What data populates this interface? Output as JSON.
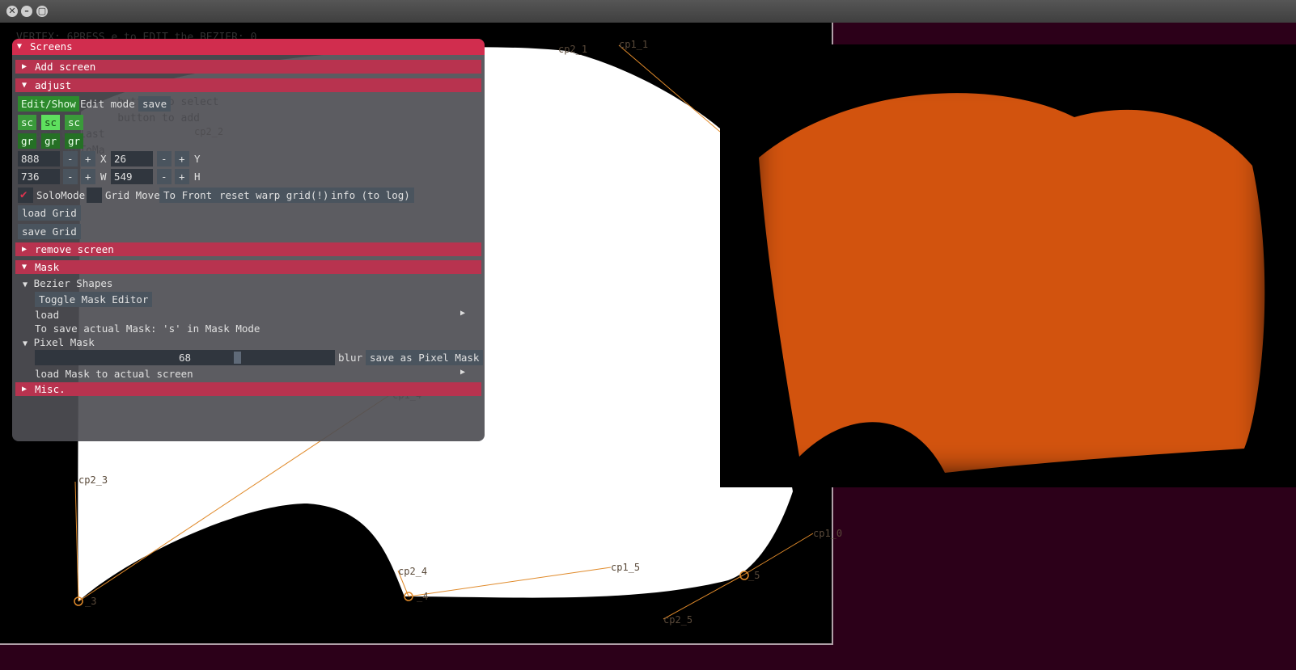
{
  "window": {
    "close_glyph": "✕",
    "min_glyph": "–",
    "max_glyph": "▢"
  },
  "background_text": "VERTEX: 6PRESS e to EDIT the BEZIER: 0\n\n\n\n                button to select\n                button to add\n   delete last\n        ntToMa",
  "control_point_labels": [
    "cp2_1",
    "cp1_1",
    "cp2_2",
    "cp1_4",
    "cp2_3",
    "_3",
    "cp2_4",
    "_4",
    "cp1_5",
    "_5",
    "cp1_0",
    "cp2_5"
  ],
  "gui": {
    "screens_header": "Screens",
    "add_screen": "Add screen",
    "adjust": "adjust",
    "edit_show": "Edit/Show",
    "edit_mode": "Edit mode",
    "save": "save",
    "sc_buttons": [
      "sc",
      "sc",
      "sc"
    ],
    "gr_buttons": [
      "gr",
      "gr",
      "gr"
    ],
    "row1": {
      "value": "888",
      "minus": "-",
      "plus": "+",
      "axis": "X",
      "value2": "26",
      "axis2": "Y"
    },
    "row2": {
      "value": "736",
      "minus": "-",
      "plus": "+",
      "axis": "W",
      "value2": "549",
      "axis2": "H"
    },
    "solo_mode": "SoloMode",
    "grid_move": "Grid Move",
    "to_front": "To Front",
    "reset_warp": "reset warp grid(!)",
    "info_log": "info (to log)",
    "load_grid": "load Grid",
    "save_grid": "save Grid",
    "remove_screen": "remove screen",
    "mask": "Mask",
    "bezier_shapes": "Bezier Shapes",
    "toggle_mask_editor": "Toggle Mask Editor",
    "load": "load",
    "save_hint": "To save actual Mask: 's' in Mask Mode",
    "pixel_mask": "Pixel Mask",
    "blur_value": "68",
    "blur_label": "blur",
    "save_pixel_mask": "save as Pixel Mask",
    "load_mask": "load Mask to actual screen",
    "misc": "Misc."
  },
  "slider": {
    "min": 0,
    "max": 100,
    "value": 68
  },
  "colors": {
    "header": "#b8334f",
    "accent_green": "#2d8a2d",
    "mask_orange": "#d2530e",
    "desktop": "#2c0019"
  }
}
